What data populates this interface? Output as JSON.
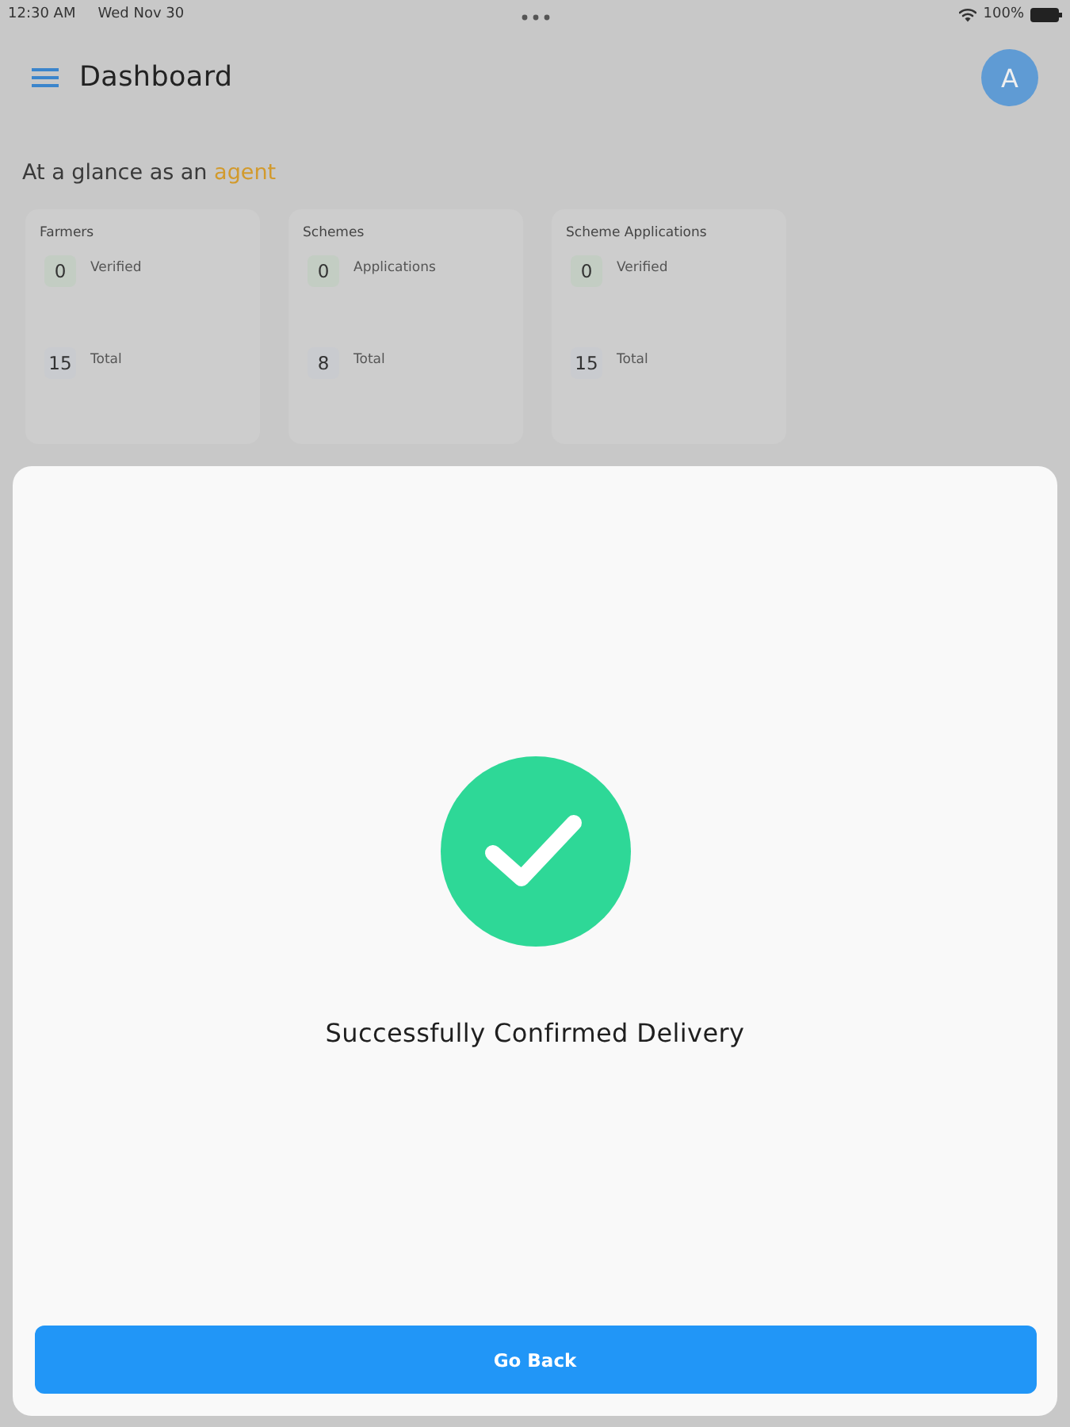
{
  "status_bar": {
    "time": "12:30 AM",
    "date": "Wed Nov 30",
    "battery": "100%"
  },
  "header": {
    "title": "Dashboard",
    "avatar": "A"
  },
  "greeting": {
    "prefix": "At a glance as an",
    "highlight": "agent"
  },
  "cards": [
    {
      "title": "Farmers",
      "stats": [
        {
          "kind": "verified",
          "value": "0",
          "label": "Verified"
        },
        {
          "kind": "total",
          "value": "15",
          "label": "Total"
        }
      ]
    },
    {
      "title": "Schemes",
      "stats": [
        {
          "kind": "verified",
          "value": "0",
          "label": "Applications"
        },
        {
          "kind": "total",
          "value": "8",
          "label": "Total"
        }
      ]
    },
    {
      "title": "Scheme Applications",
      "stats": [
        {
          "kind": "verified",
          "value": "0",
          "label": "Verified"
        },
        {
          "kind": "total",
          "value": "15",
          "label": "Total"
        }
      ]
    }
  ],
  "modal": {
    "message": "Successfully Confirmed Delivery",
    "button": "Go Back"
  }
}
